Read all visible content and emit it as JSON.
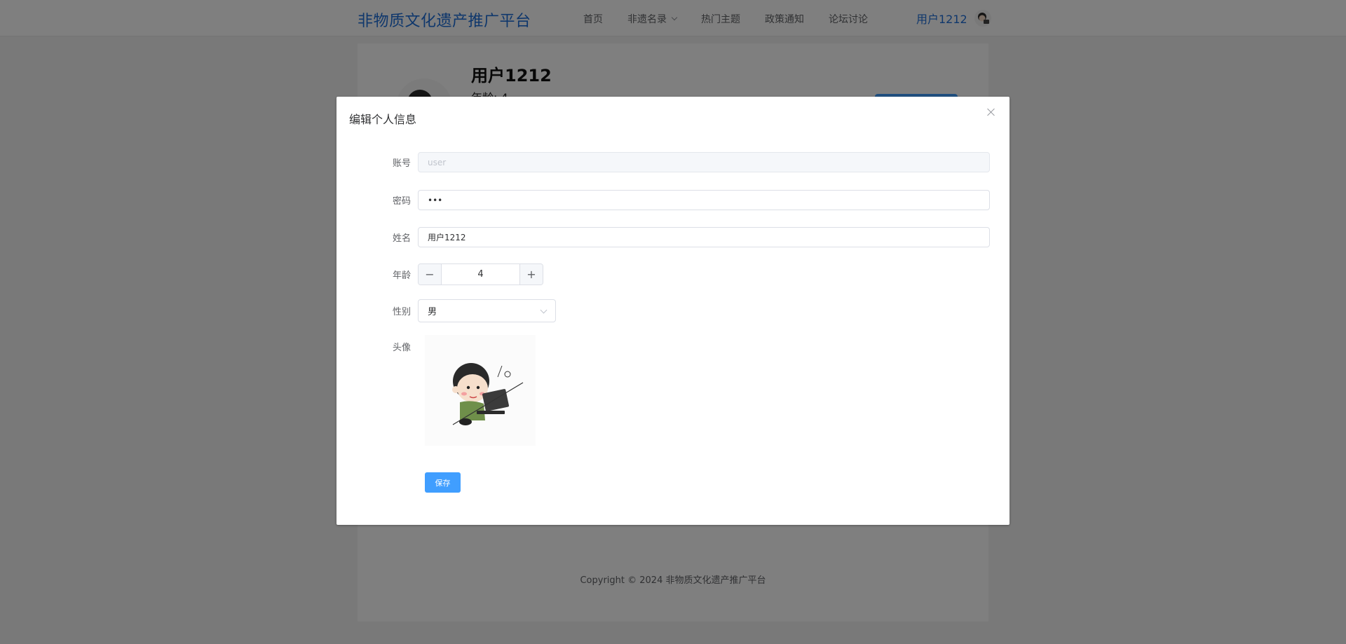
{
  "header": {
    "logo": "非物质文化遗产推广平台",
    "nav": [
      {
        "label": "首页"
      },
      {
        "label": "非遗名录",
        "has_dropdown": true
      },
      {
        "label": "热门主题"
      },
      {
        "label": "政策通知"
      },
      {
        "label": "论坛讨论"
      }
    ],
    "user_name": "用户1212"
  },
  "profile": {
    "name": "用户1212",
    "age_line": "年龄: 4"
  },
  "footer": {
    "copyright": "Copyright © 2024 非物质文化遗产推广平台"
  },
  "dialog": {
    "title": "编辑个人信息",
    "fields": {
      "account": {
        "label": "账号",
        "placeholder": "user"
      },
      "password": {
        "label": "密码",
        "value": "•••"
      },
      "name": {
        "label": "姓名",
        "value": "用户1212"
      },
      "age": {
        "label": "年龄",
        "value": "4",
        "minus": "−",
        "plus": "+"
      },
      "gender": {
        "label": "性别",
        "value": "男"
      },
      "avatar": {
        "label": "头像"
      }
    },
    "save_label": "保存"
  },
  "colors": {
    "brand": "#1e6fd9",
    "primary_button": "#409eff",
    "overlay": "rgba(0,0,0,0.5)"
  }
}
